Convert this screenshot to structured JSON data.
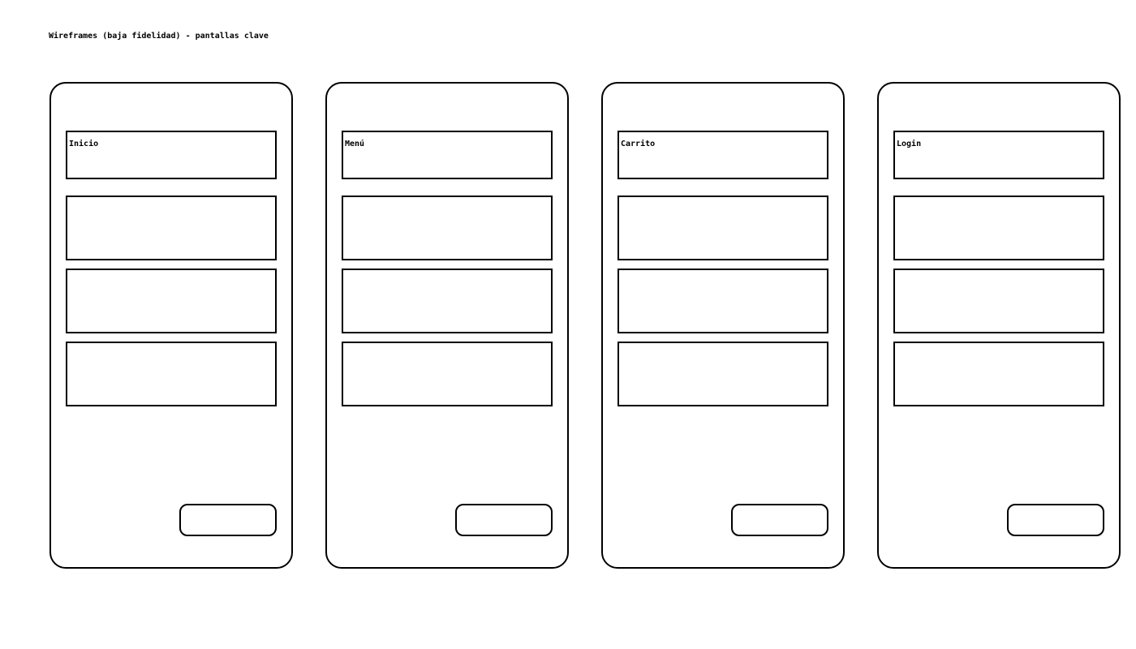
{
  "title": "Wireframes (baja fidelidad) - pantallas clave",
  "screens": [
    {
      "label": "Inicio"
    },
    {
      "label": "Menú"
    },
    {
      "label": "Carrito"
    },
    {
      "label": "Login"
    }
  ]
}
